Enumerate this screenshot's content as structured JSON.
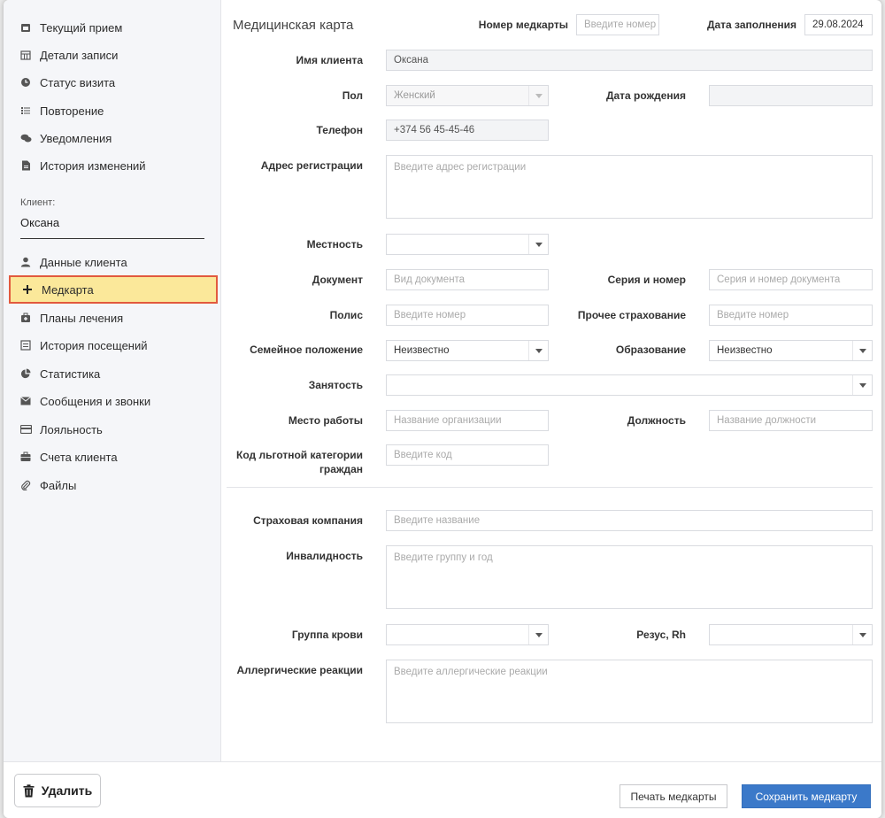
{
  "sidebar": {
    "items": [
      {
        "label": "Текущий прием",
        "icon": "calendar-check-icon"
      },
      {
        "label": "Детали записи",
        "icon": "calendar-grid-icon"
      },
      {
        "label": "Статус визита",
        "icon": "clock-icon"
      },
      {
        "label": "Повторение",
        "icon": "list-icon"
      },
      {
        "label": "Уведомления",
        "icon": "chat-bubbles-icon"
      },
      {
        "label": "История изменений",
        "icon": "document-icon"
      }
    ],
    "client_label": "Клиент:",
    "client_name": "Оксана",
    "client_items": [
      {
        "label": "Данные клиента",
        "icon": "user-icon"
      },
      {
        "label": "Медкарта",
        "icon": "plus-icon",
        "active": true
      },
      {
        "label": "Планы лечения",
        "icon": "medical-kit-icon"
      },
      {
        "label": "История посещений",
        "icon": "history-list-icon"
      },
      {
        "label": "Статистика",
        "icon": "pie-chart-icon"
      },
      {
        "label": "Сообщения и звонки",
        "icon": "envelope-icon"
      },
      {
        "label": "Лояльность",
        "icon": "card-icon"
      },
      {
        "label": "Счета клиента",
        "icon": "briefcase-icon"
      },
      {
        "label": "Файлы",
        "icon": "paperclip-icon"
      }
    ]
  },
  "form": {
    "title": "Медицинская карта",
    "card_number_label": "Номер медкарты",
    "card_number_placeholder": "Введите номер",
    "fill_date_label": "Дата заполнения",
    "fill_date_value": "29.08.2024",
    "client_name_label": "Имя клиента",
    "client_name_value": "Оксана",
    "gender_label": "Пол",
    "gender_value": "Женский",
    "birthdate_label": "Дата рождения",
    "phone_label": "Телефон",
    "phone_value": "+374 56 45-45-46",
    "address_label": "Адрес регистрации",
    "address_placeholder": "Введите адрес регистрации",
    "locality_label": "Местность",
    "document_label": "Документ",
    "document_placeholder": "Вид документа",
    "series_label": "Серия и номер",
    "series_placeholder": "Серия и номер документа",
    "policy_label": "Полис",
    "policy_placeholder": "Введите номер",
    "other_insurance_label": "Прочее страхование",
    "other_insurance_placeholder": "Введите номер",
    "marital_label": "Семейное положение",
    "marital_value": "Неизвестно",
    "education_label": "Образование",
    "education_value": "Неизвестно",
    "employment_label": "Занятость",
    "workplace_label": "Место работы",
    "workplace_placeholder": "Название организации",
    "position_label": "Должность",
    "position_placeholder": "Название должности",
    "benefit_label_line1": "Код льготной категории",
    "benefit_label_line2": "граждан",
    "benefit_placeholder": "Введите код",
    "insurance_company_label": "Страховая компания",
    "insurance_company_placeholder": "Введите название",
    "disability_label": "Инвалидность",
    "disability_placeholder": "Введите группу и год",
    "blood_group_label": "Группа крови",
    "rh_label": "Резус, Rh",
    "allergy_label": "Аллергические реакции",
    "allergy_placeholder": "Введите аллергические реакции"
  },
  "footer": {
    "delete_label": "Удалить",
    "print_label": "Печать медкарты",
    "save_label": "Сохранить медкарту"
  },
  "colors": {
    "active_bg": "#fbe89a",
    "active_border": "#e25a3e",
    "primary": "#3b79c9"
  }
}
